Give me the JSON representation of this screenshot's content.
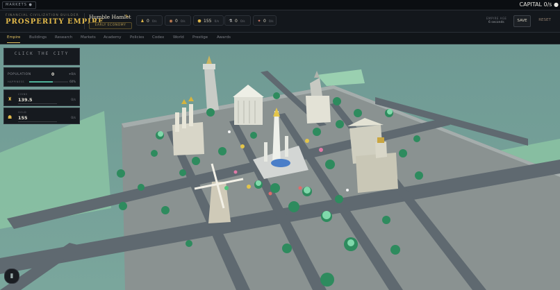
{
  "topbar": {
    "markets_label": "MARKETS ●",
    "capital_text": "CAPITAL 0/s ●"
  },
  "brand": {
    "subtitle": "FINANCIAL CIVILIZATION BUILDER",
    "title": "PROSPERITY EMPIRE"
  },
  "city": {
    "name": "Humble Hamlet",
    "stage": "EARLY ECONOMY"
  },
  "resources": [
    {
      "icon": "worker-icon",
      "glyph": "♟",
      "value": "0",
      "rate": "0/s",
      "color": "#e0b84a"
    },
    {
      "icon": "food-icon",
      "glyph": "◉",
      "value": "0",
      "rate": "0/s",
      "color": "#d98b5a"
    },
    {
      "icon": "gold-icon",
      "glyph": "⬣",
      "value": "155",
      "rate": "0/s",
      "color": "#e0b84a"
    },
    {
      "icon": "science-icon",
      "glyph": "⚗",
      "value": "0",
      "rate": "0/s",
      "color": "#cfcfcf"
    },
    {
      "icon": "influence-icon",
      "glyph": "✦",
      "value": "0",
      "rate": "0/s",
      "color": "#e07f6a"
    }
  ],
  "empire_age": {
    "label": "EMPIRE AGE",
    "value": "6 seconds"
  },
  "buttons": {
    "save": "SAVE",
    "reset": "RESET"
  },
  "tabs": [
    "Empire",
    "Buildings",
    "Research",
    "Markets",
    "Academy",
    "Policies",
    "Codex",
    "World",
    "Prestige",
    "Awards"
  ],
  "active_tab": "Empire",
  "click_button": "CLICK THE CITY",
  "population": {
    "label": "POPULATION",
    "value": "0",
    "rate": "+0/s",
    "happiness_label": "HAPPINESS",
    "happiness_pct": "60%",
    "happiness_fraction": 0.6
  },
  "side_resources": [
    {
      "icon": "coin-icon",
      "glyph": "♜",
      "label": "COINS",
      "value": "139.5",
      "rate": "0/s"
    },
    {
      "icon": "gold-bag-icon",
      "glyph": "☗",
      "label": "GOLD",
      "value": "155",
      "rate": "0/s"
    }
  ],
  "colors": {
    "accent": "#e0b84a",
    "ground": "#7a8a7e",
    "road": "#59636b",
    "grass": "#6fb493"
  }
}
